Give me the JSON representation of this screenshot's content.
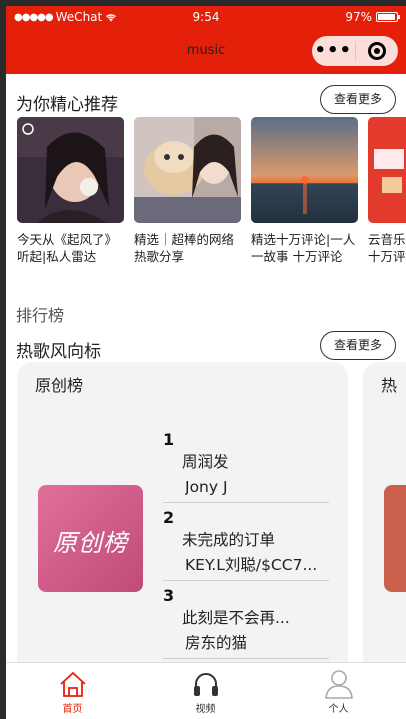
{
  "status_bar": {
    "carrier": "WeChat",
    "time": "9:54",
    "battery": "97%"
  },
  "nav": {
    "title": "music"
  },
  "recommend": {
    "heading": "为你精心推荐",
    "more_label": "查看更多",
    "items": [
      {
        "title": "今天从《起风了》听起|私人雷达"
      },
      {
        "title": "精选｜超棒的网络热歌分享"
      },
      {
        "title": "精选十万评论|一人一故事 十万评论"
      },
      {
        "title": "云音乐特别推荐 过十万评"
      }
    ]
  },
  "ranking": {
    "label": "排行榜",
    "heading": "热歌风向标",
    "more_label": "查看更多",
    "cards": [
      {
        "title": "原创榜",
        "cover_text": "原创榜",
        "songs": [
          {
            "rank": "1",
            "name": "周润发",
            "artist": "Jony J"
          },
          {
            "rank": "2",
            "name": "未完成的订单",
            "artist": "KEY.L刘聪/$CC7..."
          },
          {
            "rank": "3",
            "name": "此刻是不会再...",
            "artist": "房东的猫"
          }
        ]
      },
      {
        "title": "热"
      }
    ]
  },
  "tabbar": {
    "tabs": [
      {
        "label": "首页",
        "icon": "home-icon",
        "active": true
      },
      {
        "label": "视频",
        "icon": "headphones-icon",
        "active": false
      },
      {
        "label": "个人",
        "icon": "user-icon",
        "active": false
      }
    ]
  },
  "colors": {
    "brand": "#e5200a",
    "card_bg": "#f3f3f3"
  }
}
